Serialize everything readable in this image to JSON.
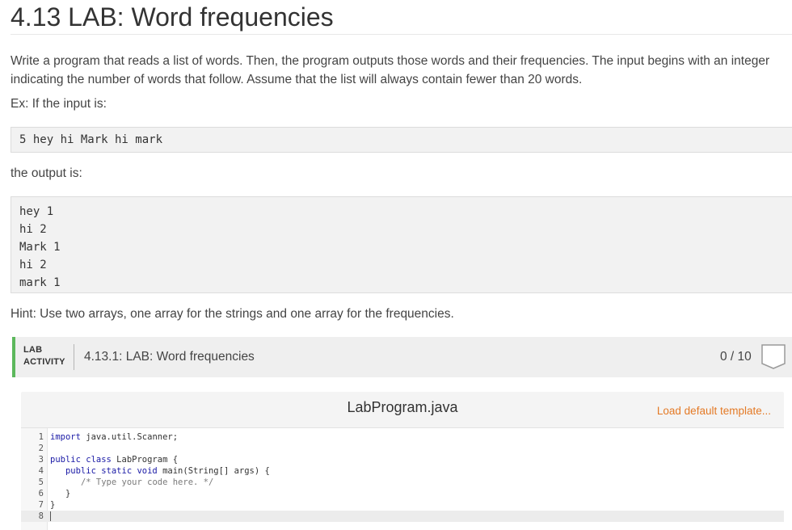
{
  "page": {
    "title": "4.13 LAB: Word frequencies",
    "description": "Write a program that reads a list of words. Then, the program outputs those words and their frequencies. The input begins with an integer indicating the number of words that follow. Assume that the list will always contain fewer than 20 words.",
    "example_label": "Ex: If the input is:",
    "example_input": "5 hey hi Mark hi mark",
    "output_label": "the output is:",
    "example_output": [
      "hey 1",
      "hi 2",
      "Mark 1",
      "hi 2",
      "mark 1"
    ],
    "hint": "Hint: Use two arrays, one array for the strings and one array for the frequencies."
  },
  "lab": {
    "tag_line1": "LAB",
    "tag_line2": "ACTIVITY",
    "name": "4.13.1: LAB: Word frequencies",
    "score": "0 / 10",
    "accent_color": "#5cb85c"
  },
  "editor": {
    "file_name": "LabProgram.java",
    "load_template": "Load default template...",
    "lines": [
      {
        "num": "1",
        "parts": [
          {
            "t": "import",
            "c": "kw"
          },
          {
            "t": " java.util.Scanner;",
            "c": ""
          }
        ]
      },
      {
        "num": "2",
        "parts": []
      },
      {
        "num": "3",
        "parts": [
          {
            "t": "public class",
            "c": "kw"
          },
          {
            "t": " LabProgram {",
            "c": ""
          }
        ]
      },
      {
        "num": "4",
        "parts": [
          {
            "t": "   ",
            "c": ""
          },
          {
            "t": "public static void",
            "c": "kw"
          },
          {
            "t": " main(String[] args) {",
            "c": ""
          }
        ]
      },
      {
        "num": "5",
        "parts": [
          {
            "t": "      ",
            "c": ""
          },
          {
            "t": "/* Type your code here. */",
            "c": "cm"
          }
        ]
      },
      {
        "num": "6",
        "parts": [
          {
            "t": "   }",
            "c": ""
          }
        ]
      },
      {
        "num": "7",
        "parts": [
          {
            "t": "}",
            "c": ""
          }
        ]
      },
      {
        "num": "8",
        "parts": []
      }
    ]
  }
}
